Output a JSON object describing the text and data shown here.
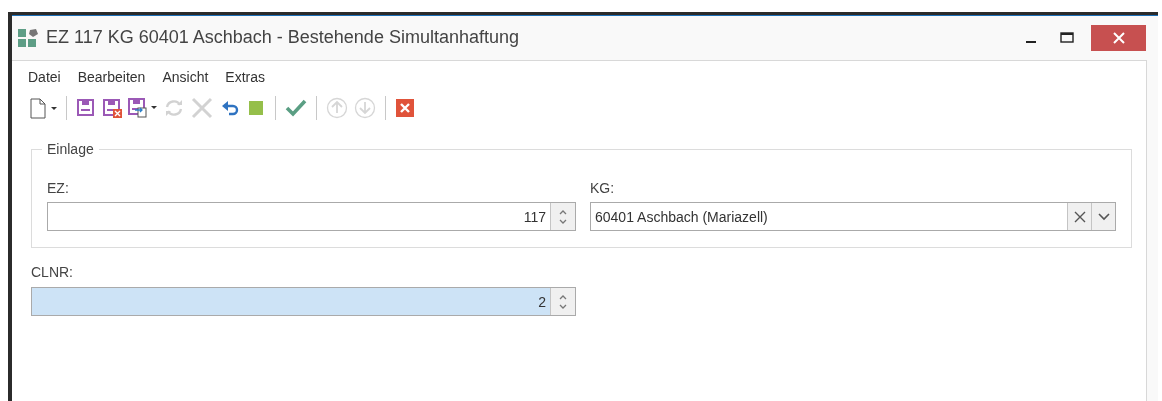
{
  "window": {
    "title": "EZ 117 KG 60401 Aschbach - Bestehende Simultanhaftung"
  },
  "menu": [
    "Datei",
    "Bearbeiten",
    "Ansicht",
    "Extras"
  ],
  "toolbar": [
    {
      "kind": "new",
      "disabled": false
    },
    {
      "kind": "separator"
    },
    {
      "kind": "save",
      "disabled": false
    },
    {
      "kind": "save-discard",
      "disabled": false
    },
    {
      "kind": "save-export",
      "disabled": false
    },
    {
      "kind": "refresh",
      "disabled": true
    },
    {
      "kind": "cancel",
      "disabled": true
    },
    {
      "kind": "undo",
      "disabled": false
    },
    {
      "kind": "stop",
      "disabled": false
    },
    {
      "kind": "separator"
    },
    {
      "kind": "confirm",
      "disabled": false
    },
    {
      "kind": "separator"
    },
    {
      "kind": "up",
      "disabled": true
    },
    {
      "kind": "down",
      "disabled": true
    },
    {
      "kind": "separator"
    },
    {
      "kind": "close",
      "disabled": false
    }
  ],
  "group": {
    "title": "Einlage",
    "ez": {
      "label": "EZ:",
      "value": "117"
    },
    "kg": {
      "label": "KG:",
      "value": "60401 Aschbach (Mariazell)"
    }
  },
  "clnr": {
    "label": "CLNR:",
    "value": "2",
    "focused": true
  }
}
